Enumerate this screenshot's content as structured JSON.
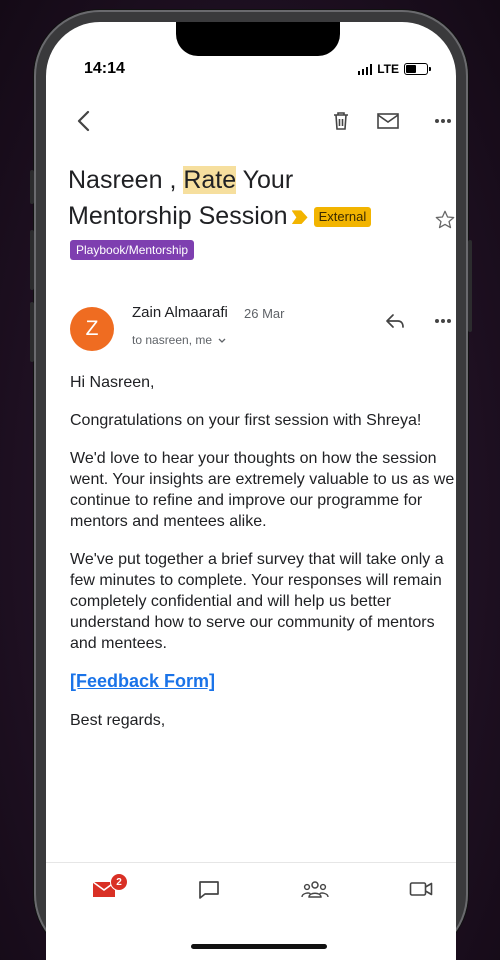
{
  "status_bar": {
    "time": "14:14",
    "network": "LTE",
    "battery_level": 0.45
  },
  "header": {
    "back_icon": "chevron-left-icon",
    "actions": [
      "delete-icon",
      "mail-icon",
      "more-icon"
    ]
  },
  "subject": {
    "prefix": "Nasreen , ",
    "highlight": "Rate",
    "rest": " Your Mentorship Session",
    "tag": "External",
    "label": "Playbook/Mentorship"
  },
  "message": {
    "avatar_letter": "Z",
    "sender": "Zain Almaarafi",
    "date": "26 Mar",
    "recipients": "to nasreen, me",
    "greeting": "Hi Nasreen,",
    "paragraph1": "Congratulations on your first session with Shreya!",
    "paragraph2": "We'd love to hear your thoughts on how the session went. Your insights are extremely valuable to us as we continue to refine and improve our programme for mentors and mentees alike.",
    "paragraph3": "We've put together a brief survey that will take only a few minutes to complete. Your responses will remain completely confidential and will help us better understand how to serve our community of mentors and mentees.",
    "link_text": "[Feedback Form]",
    "signoff": "Best regards,"
  },
  "tabbar": {
    "mail_badge": "2"
  },
  "colors": {
    "accent": "#d93025",
    "external_tag": "#f2b400",
    "label": "#7e3fb0",
    "avatar": "#ef6c21",
    "link": "#1a73e8"
  }
}
